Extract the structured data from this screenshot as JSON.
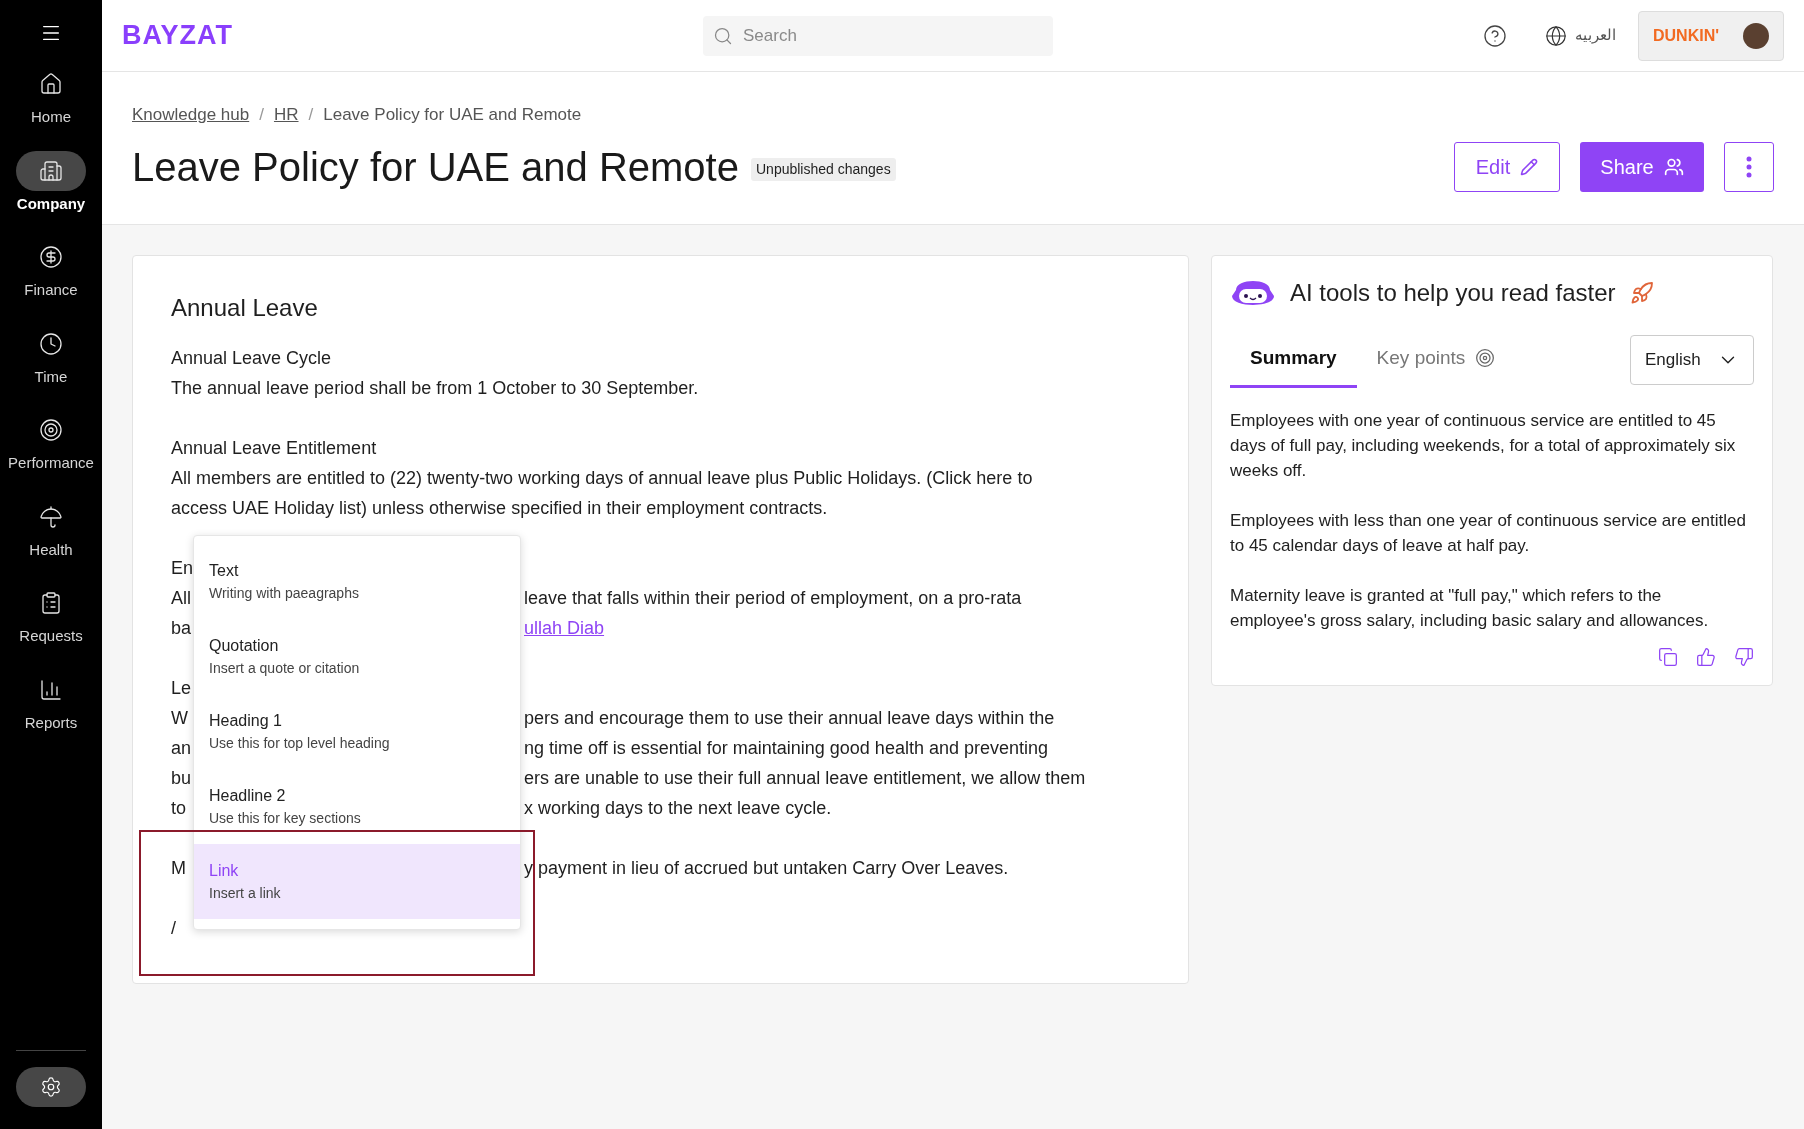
{
  "sidebar": {
    "items": [
      {
        "label": "Home",
        "selected": false
      },
      {
        "label": "Company",
        "selected": true
      },
      {
        "label": "Finance",
        "selected": false
      },
      {
        "label": "Time",
        "selected": false
      },
      {
        "label": "Performance",
        "selected": false
      },
      {
        "label": "Health",
        "selected": false
      },
      {
        "label": "Requests",
        "selected": false
      },
      {
        "label": "Reports",
        "selected": false
      }
    ]
  },
  "header": {
    "logo": "BAYZAT",
    "search": {
      "placeholder": "Search"
    },
    "language": "العربيه",
    "company_logo": "DUNKIN'"
  },
  "breadcrumbs": [
    {
      "label": "Knowledge hub",
      "kind": "link"
    },
    {
      "label": "/",
      "kind": "separator"
    },
    {
      "label": "HR",
      "kind": "link"
    },
    {
      "label": "/",
      "kind": "separator"
    },
    {
      "label": "Leave Policy for UAE and Remote",
      "kind": "current"
    }
  ],
  "page": {
    "title": "Leave Policy for UAE and Remote",
    "badge": "Unpublished changes",
    "buttons": [
      {
        "label": "Edit",
        "kind": "outline"
      },
      {
        "label": "Share",
        "kind": "primary"
      }
    ]
  },
  "editor": {
    "heading": "Annual Leave",
    "paragraphs": [
      {
        "lines": [
          {
            "left": "Annual Leave Cycle"
          },
          {
            "left": "The annual leave period shall be from 1 October to 30 September."
          }
        ]
      },
      {
        "lines": [
          {
            "left": "Annual Leave Entitlement"
          },
          {
            "left": "All members are entitled to (22) twenty-two working days of annual leave plus Public Holidays. (Click here to"
          },
          {
            "left": "access UAE Holiday list) unless otherwise specified in their employment contracts."
          }
        ]
      },
      {
        "lines": [
          {
            "left": "En"
          },
          {
            "left": "All",
            "right": "leave that falls within their period of employment, on a pro-rata"
          },
          {
            "left": "ba",
            "right": "ullah Diab",
            "right_link": true
          }
        ]
      },
      {
        "lines": [
          {
            "left": "Le"
          },
          {
            "left": "W",
            "right": "pers and encourage them to use their annual leave days within the"
          },
          {
            "left": "an",
            "right": "ng time off is essential for maintaining good health and preventing"
          },
          {
            "left": "bu",
            "right": "ers are unable to use their full annual leave entitlement, we allow them"
          },
          {
            "left": "to",
            "right": "x working days to the next leave cycle."
          }
        ]
      },
      {
        "lines": [
          {
            "left": "M",
            "right": "y payment in lieu of accrued but untaken Carry Over Leaves."
          }
        ]
      },
      {
        "lines": [
          {
            "left": "/"
          }
        ]
      }
    ],
    "menu": [
      {
        "title": "Text",
        "description": "Writing with paeagraphs",
        "selected": false
      },
      {
        "title": "Quotation",
        "description": "Insert a quote or citation",
        "selected": false
      },
      {
        "title": "Heading 1",
        "description": "Use this for top level heading",
        "selected": false
      },
      {
        "title": "Headline 2",
        "description": "Use this for key sections",
        "selected": false
      },
      {
        "title": "Link",
        "description": "Insert a link",
        "selected": true
      }
    ]
  },
  "ai_panel": {
    "title": "AI tools to help you read faster",
    "tabs": [
      {
        "label": "Summary",
        "selected": true
      },
      {
        "label": "Key points",
        "selected": false
      }
    ],
    "language": "English",
    "paragraphs": [
      "Employees with one year of continuous service are entitled to 45 days of full pay, including weekends, for a total of approximately six weeks off.",
      "Employees with less than one year of continuous service are entitled to 45 calendar days of leave at half pay.",
      "Maternity leave is granted at \"full pay,\" which refers to the employee's gross salary, including basic salary and allowances."
    ]
  }
}
